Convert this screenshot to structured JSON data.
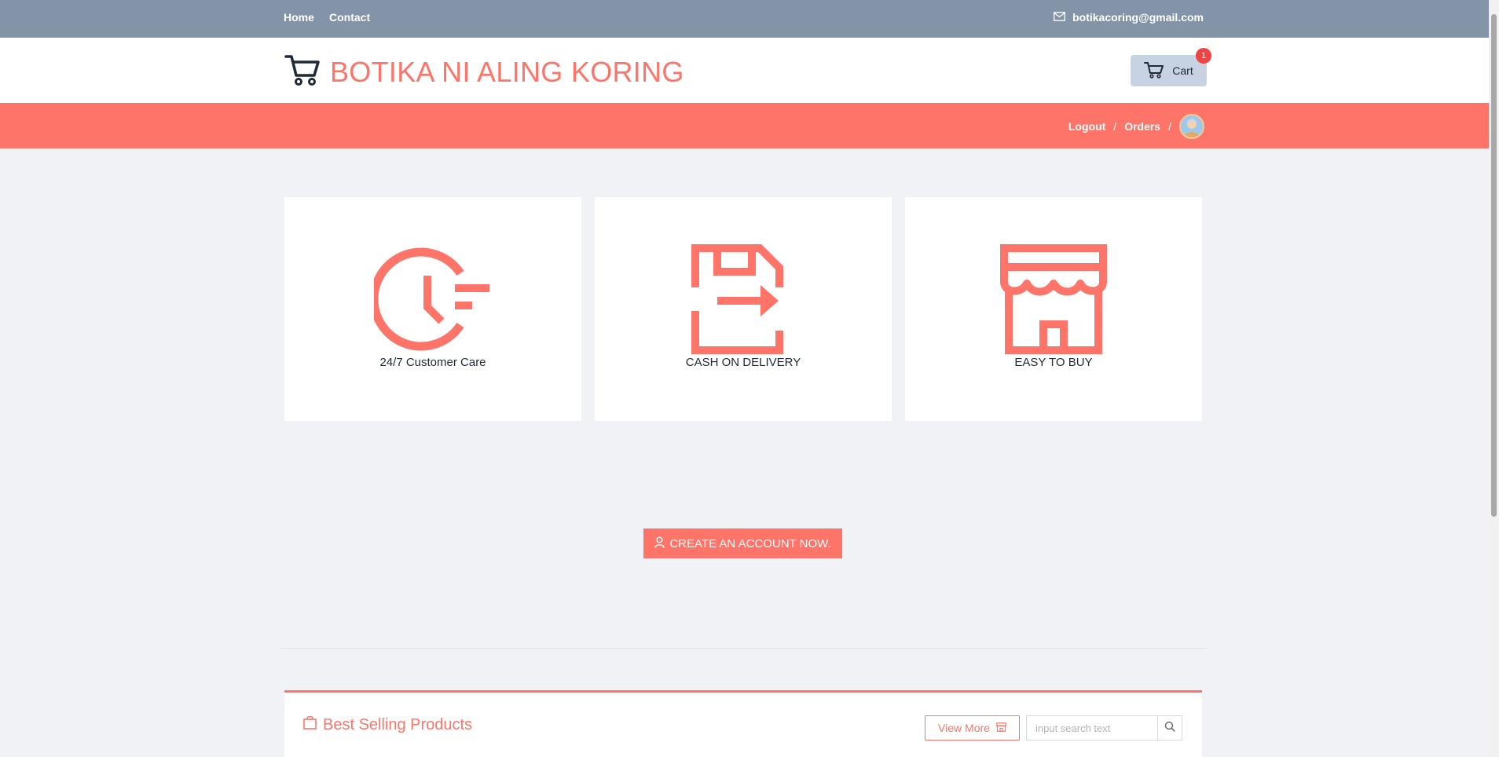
{
  "topbar": {
    "nav": [
      {
        "label": "Home"
      },
      {
        "label": "Contact"
      }
    ],
    "email": "botikacoring@gmail.com"
  },
  "header": {
    "brand_title": "BOTIKA NI ALING KORING",
    "cart_label": "Cart",
    "cart_count": "1"
  },
  "subbar": {
    "logout_label": "Logout",
    "orders_label": "Orders",
    "separator": "/"
  },
  "features": [
    {
      "label": "24/7 Customer Care",
      "icon": "clock-icon"
    },
    {
      "label": "CASH ON DELIVERY",
      "icon": "delivery-arrow-icon"
    },
    {
      "label": "EASY TO BUY",
      "icon": "storefront-icon"
    }
  ],
  "cta": {
    "create_account_label": "CREATE AN ACCOUNT NOW."
  },
  "products": {
    "title": "Best Selling Products",
    "view_more_label": "View More",
    "search_placeholder": "input search text"
  },
  "colors": {
    "accent": "#ff7468",
    "topbar": "#8494a8",
    "cart_button": "#c7d3e2",
    "background": "#f0f2f5"
  }
}
